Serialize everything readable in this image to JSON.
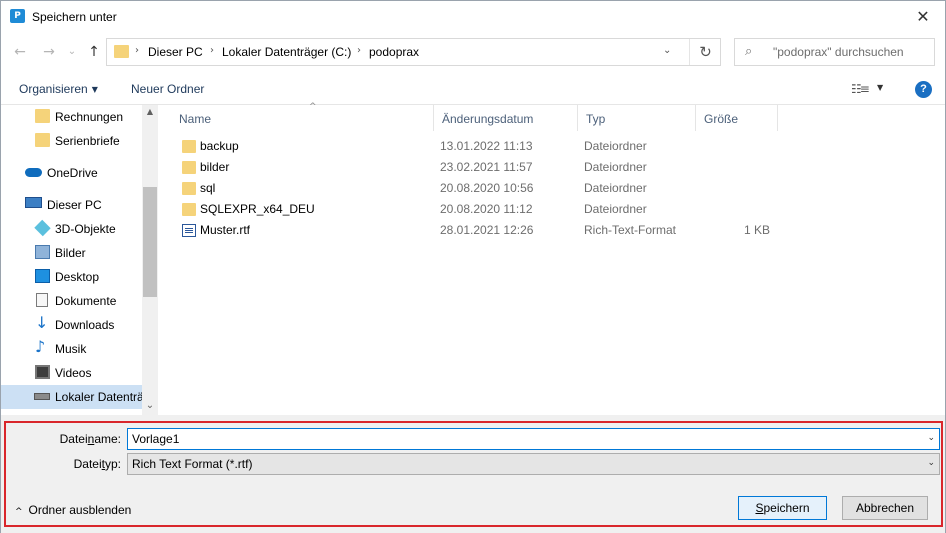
{
  "window": {
    "title": "Speichern unter",
    "icon": "P",
    "close_glyph": "✕"
  },
  "nav_buttons": {
    "back": "←",
    "forward": "→",
    "recent": "⌄",
    "up": "↑"
  },
  "address": {
    "segments": [
      "Dieser PC",
      "Lokaler Datenträger (C:)",
      "podoprax"
    ],
    "separator": "›",
    "dropdown": "⌄",
    "refresh": "↻"
  },
  "search": {
    "placeholder": "\"podoprax\" durchsuchen",
    "icon": "⌕"
  },
  "toolbar": {
    "organize": "Organisieren",
    "new_folder": "Neuer Ordner",
    "caret": "▼",
    "view_icon": "☷≡",
    "help": "?"
  },
  "sidebar": {
    "items": [
      {
        "label": "Rechnungen",
        "icon": "folder-icon"
      },
      {
        "label": "Serienbriefe",
        "icon": "folder-icon"
      },
      {
        "label": "OneDrive",
        "icon": "cloud-icon"
      },
      {
        "label": "Dieser PC",
        "icon": "computer-icon"
      },
      {
        "label": "3D-Objekte",
        "icon": "cube-icon"
      },
      {
        "label": "Bilder",
        "icon": "pictures-icon"
      },
      {
        "label": "Desktop",
        "icon": "desktop-icon"
      },
      {
        "label": "Dokumente",
        "icon": "documents-icon"
      },
      {
        "label": "Downloads",
        "icon": "download-icon"
      },
      {
        "label": "Musik",
        "icon": "music-icon"
      },
      {
        "label": "Videos",
        "icon": "video-icon"
      },
      {
        "label": "Lokaler Datenträ",
        "icon": "drive-icon",
        "selected": true
      }
    ],
    "scroll_up": "▲",
    "scroll_down": "⌄"
  },
  "file_list": {
    "columns": [
      "Name",
      "Änderungsdatum",
      "Typ",
      "Größe"
    ],
    "sort_indicator": "^",
    "rows": [
      {
        "name": "backup",
        "date": "13.01.2022 11:13",
        "type": "Dateiordner",
        "size": "",
        "icon": "folder-icon"
      },
      {
        "name": "bilder",
        "date": "23.02.2021 11:57",
        "type": "Dateiordner",
        "size": "",
        "icon": "folder-icon"
      },
      {
        "name": "sql",
        "date": "20.08.2020 10:56",
        "type": "Dateiordner",
        "size": "",
        "icon": "folder-icon"
      },
      {
        "name": "SQLEXPR_x64_DEU",
        "date": "20.08.2020 11:12",
        "type": "Dateiordner",
        "size": "",
        "icon": "folder-icon"
      },
      {
        "name": "Muster.rtf",
        "date": "28.01.2021 12:26",
        "type": "Rich-Text-Format",
        "size": "1 KB",
        "icon": "rtf-document-icon"
      }
    ]
  },
  "save_form": {
    "filename_label_pre": "Datei",
    "filename_label_u": "n",
    "filename_label_post": "ame:",
    "filename_value": "Vorlage1",
    "filetype_label_pre": "Datei",
    "filetype_label_u": "t",
    "filetype_label_post": "yp:",
    "filetype_value": "Rich Text Format (*.rtf)",
    "dropdown": "⌄",
    "hide_folders": "Ordner ausblenden",
    "hide_folders_chevron": "^",
    "save_pre": "",
    "save_u": "S",
    "save_post": "peichern",
    "cancel": "Abbrechen"
  },
  "colors": {
    "accent": "#0078d7",
    "highlight_border": "#d9262b",
    "selected_bg": "#cce0f4",
    "folder": "#f5d37a"
  }
}
